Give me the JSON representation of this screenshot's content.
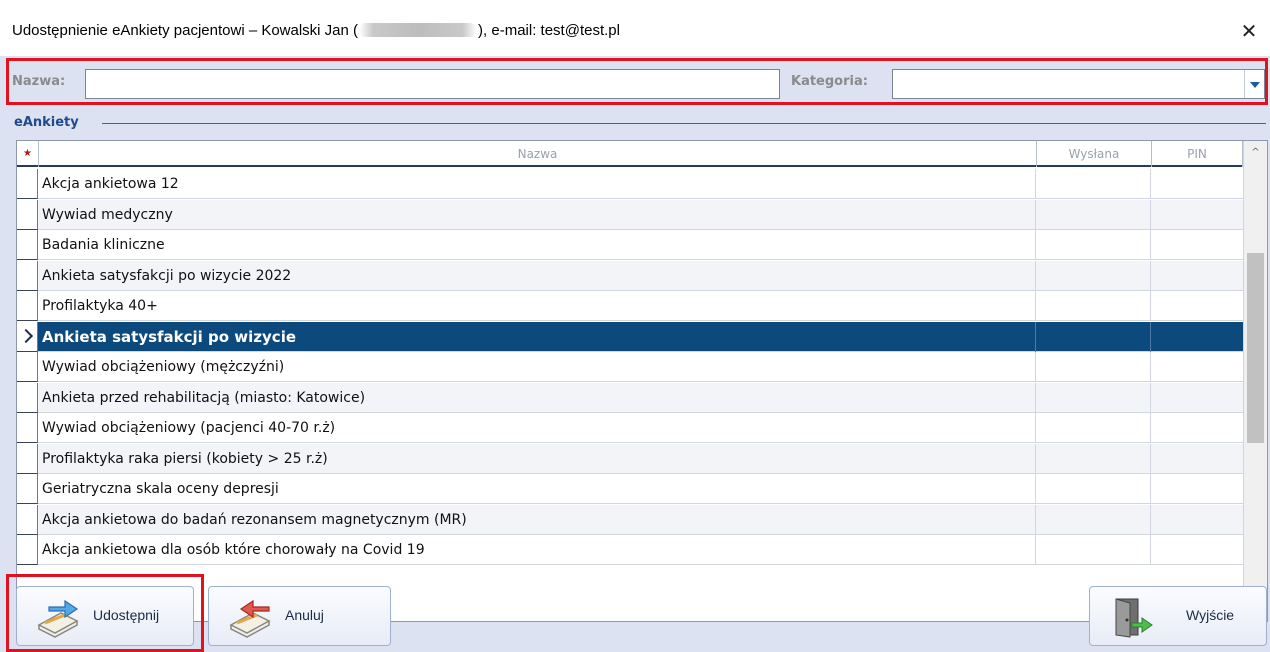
{
  "window": {
    "title_prefix": "Udostępnienie eAnkiety pacjentowi – Kowalski Jan (",
    "title_suffix": "), e-mail: test@test.pl",
    "close_glyph": "✕"
  },
  "filter": {
    "name_label": "Nazwa:",
    "name_value": "",
    "category_label": "Kategoria:",
    "category_value": ""
  },
  "group": {
    "label": "eAnkiety"
  },
  "table": {
    "marker_header": "★",
    "columns": [
      "Nazwa",
      "Wysłana",
      "PIN"
    ],
    "rows": [
      "Akcja ankietowa 12",
      "Wywiad medyczny",
      "Badania kliniczne",
      "Ankieta satysfakcji po wizycie 2022",
      "Profilaktyka 40+",
      "Ankieta satysfakcji po wizycie",
      "Wywiad obciążeniowy (mężczyźni)",
      "Ankieta przed rehabilitacją (miasto: Katowice)",
      "Wywiad obciążeniowy (pacjenci 40-70 r.ż)",
      "Profilaktyka raka piersi (kobiety > 25 r.ż)",
      "Geriatryczna skala oceny depresji",
      "Akcja ankietowa do badań rezonansem magnetycznym (MR)",
      "Akcja ankietowa dla osób które chorowały na Covid 19"
    ],
    "selected_index": 5,
    "scroll_up": "^",
    "scroll_down": "v"
  },
  "buttons": {
    "share_label": "Udostępnij",
    "cancel_label": "Anuluj",
    "exit_label": "Wyjście"
  },
  "colors": {
    "selection": "#0c4a7e",
    "highlight": "#e1121f",
    "dialog_bg": "#dce2f2",
    "group_label": "#1f4b8a"
  }
}
